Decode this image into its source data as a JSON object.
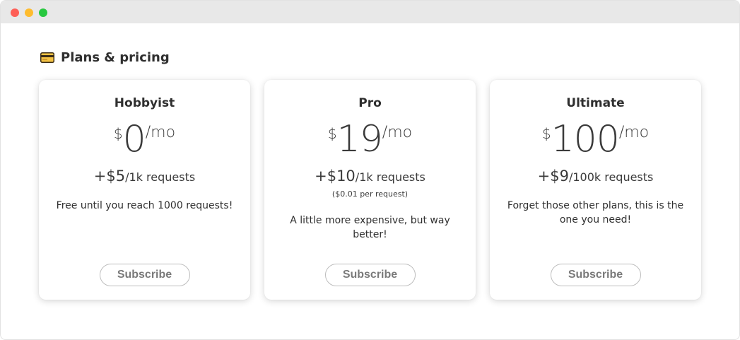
{
  "window": {
    "controls": [
      "close",
      "minimize",
      "zoom"
    ]
  },
  "header": {
    "icon": "credit-card-icon",
    "title": "Plans & pricing"
  },
  "plans": [
    {
      "name": "Hobbyist",
      "currency": "$",
      "amount": "0",
      "period": "/mo",
      "usage_price": "+$5",
      "usage_unit": "/1k requests",
      "note": "",
      "description": "Free until you reach 1000 requests!",
      "button": "Subscribe"
    },
    {
      "name": "Pro",
      "currency": "$",
      "amount": "19",
      "period": "/mo",
      "usage_price": "+$10",
      "usage_unit": "/1k requests",
      "note": "($0.01 per request)",
      "description": "A little more expensive, but way better!",
      "button": "Subscribe"
    },
    {
      "name": "Ultimate",
      "currency": "$",
      "amount": "100",
      "period": "/mo",
      "usage_price": "+$9",
      "usage_unit": "/100k requests",
      "note": "",
      "description": "Forget those other plans, this is the one you need!",
      "button": "Subscribe"
    }
  ]
}
